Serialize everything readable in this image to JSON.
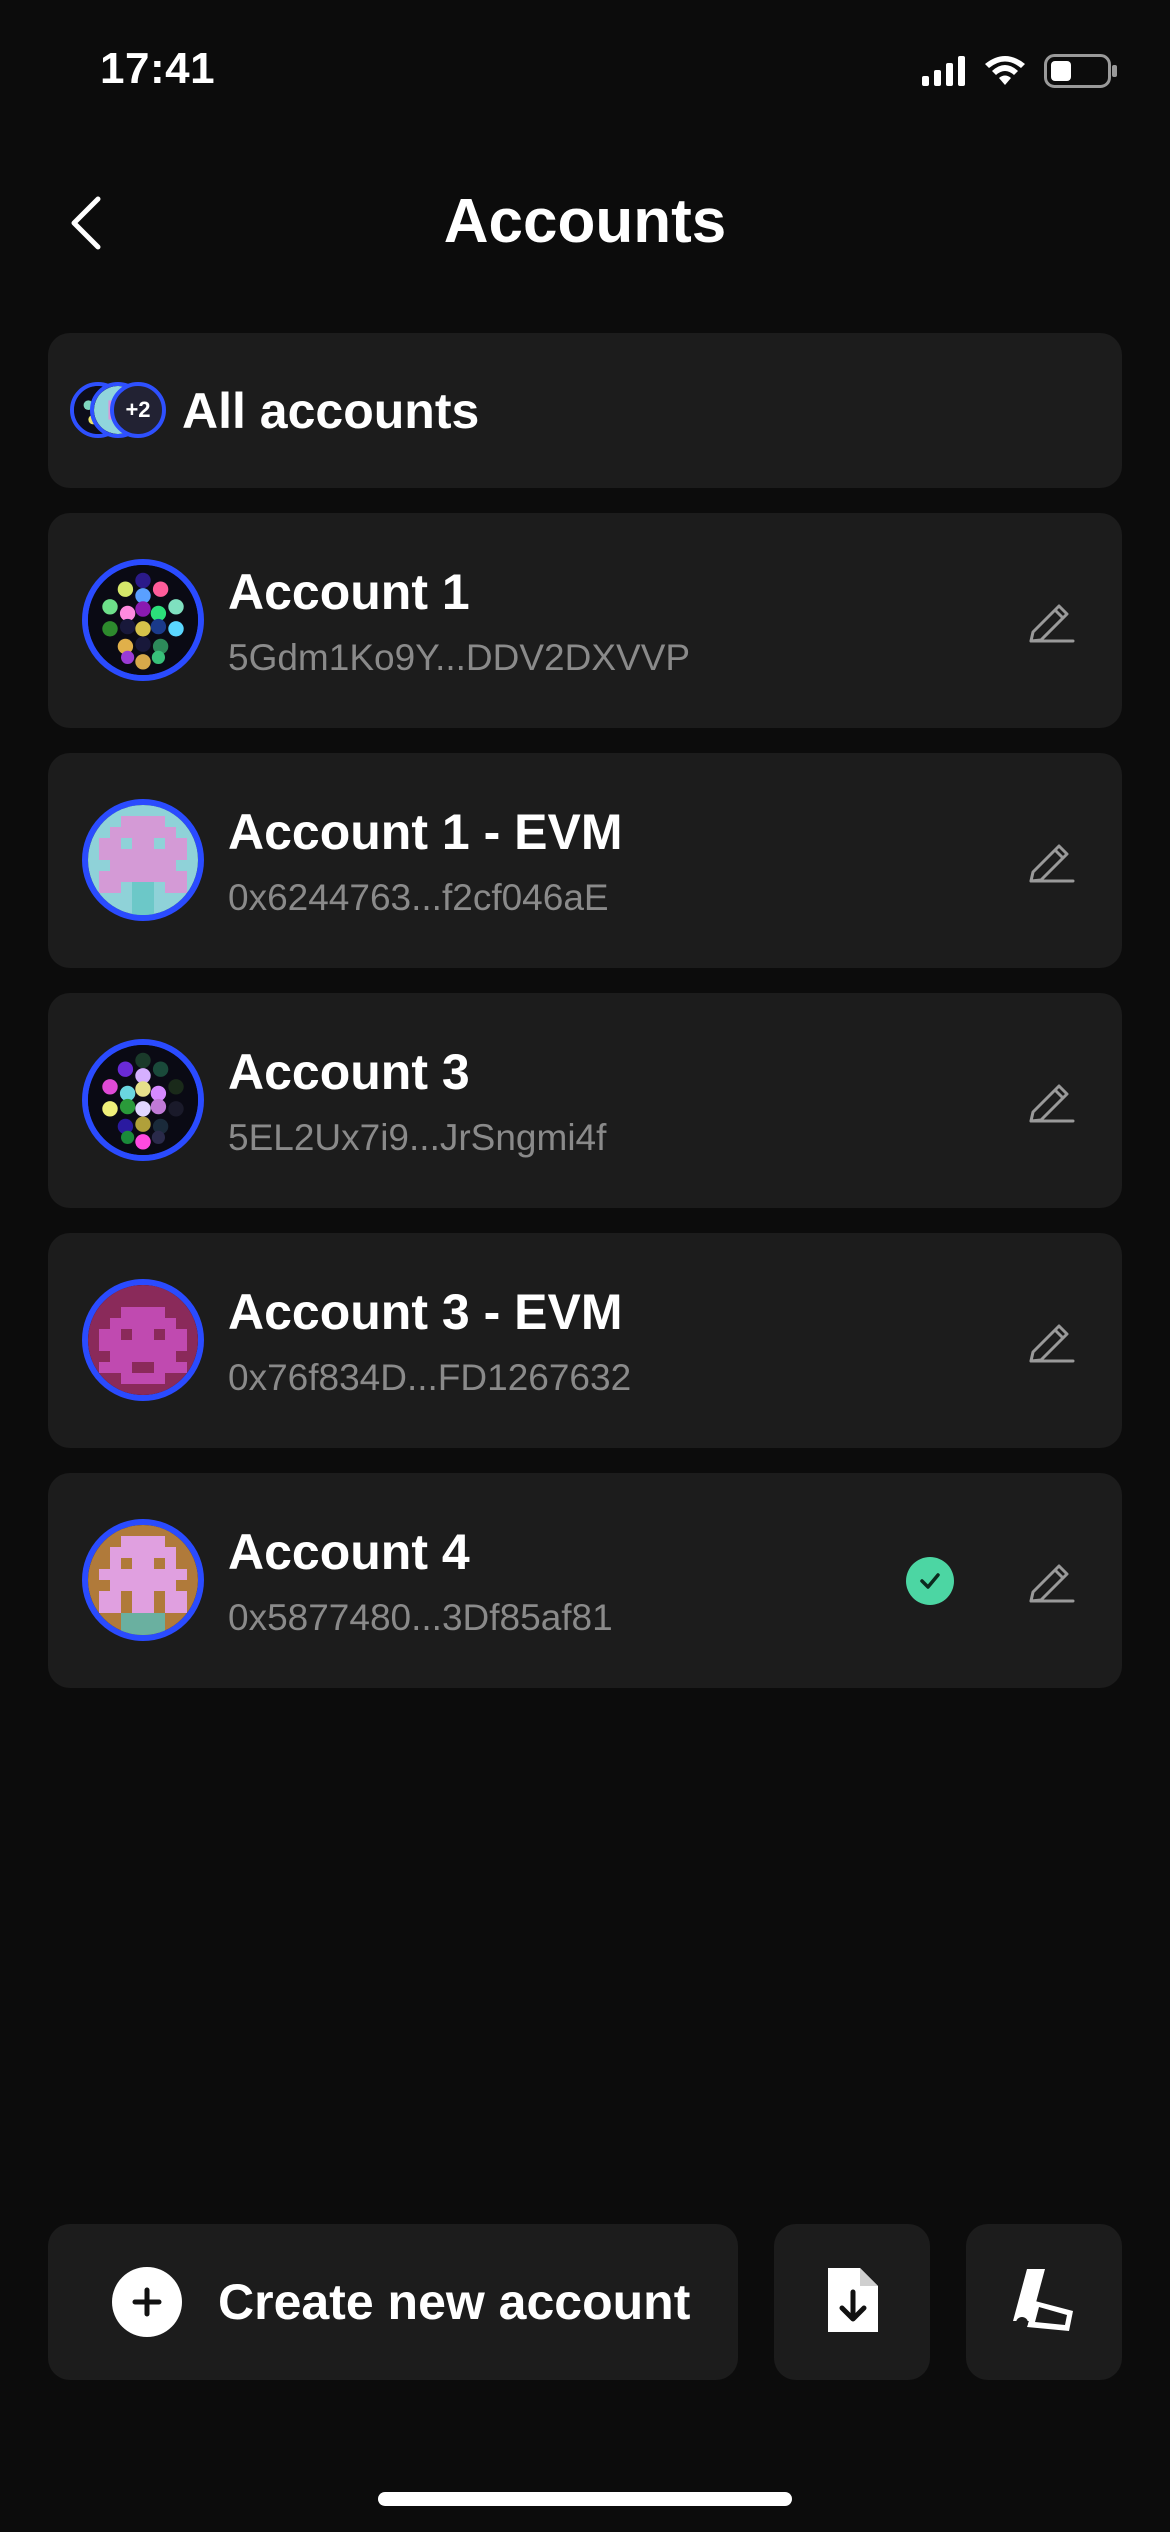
{
  "status_bar": {
    "time": "17:41"
  },
  "header": {
    "title": "Accounts"
  },
  "all_accounts": {
    "label": "All accounts",
    "count_badge": "+2"
  },
  "accounts": [
    {
      "name": "Account 1",
      "address": "5Gdm1Ko9Y...DDV2DXVVP",
      "selected": false
    },
    {
      "name": "Account 1 - EVM",
      "address": "0x6244763...f2cf046aE",
      "selected": false
    },
    {
      "name": "Account 3",
      "address": "5EL2Ux7i9...JrSngmi4f",
      "selected": false
    },
    {
      "name": "Account 3 - EVM",
      "address": "0x76f834D...FD1267632",
      "selected": false
    },
    {
      "name": "Account 4",
      "address": "0x5877480...3Df85af81",
      "selected": true
    }
  ],
  "actions": {
    "create_label": "Create new account"
  },
  "colors": {
    "background": "#0c0c0c",
    "card": "#1c1c1c",
    "avatar_ring": "#2a4bff",
    "selected_check": "#4cd6a3",
    "secondary_text": "#8a8a8a"
  },
  "icons": {
    "back": "chevron-left-icon",
    "edit": "pencil-icon",
    "selected": "check-circle-icon",
    "create": "plus-circle-icon",
    "import": "file-download-icon",
    "ledger": "ledger-icon"
  }
}
